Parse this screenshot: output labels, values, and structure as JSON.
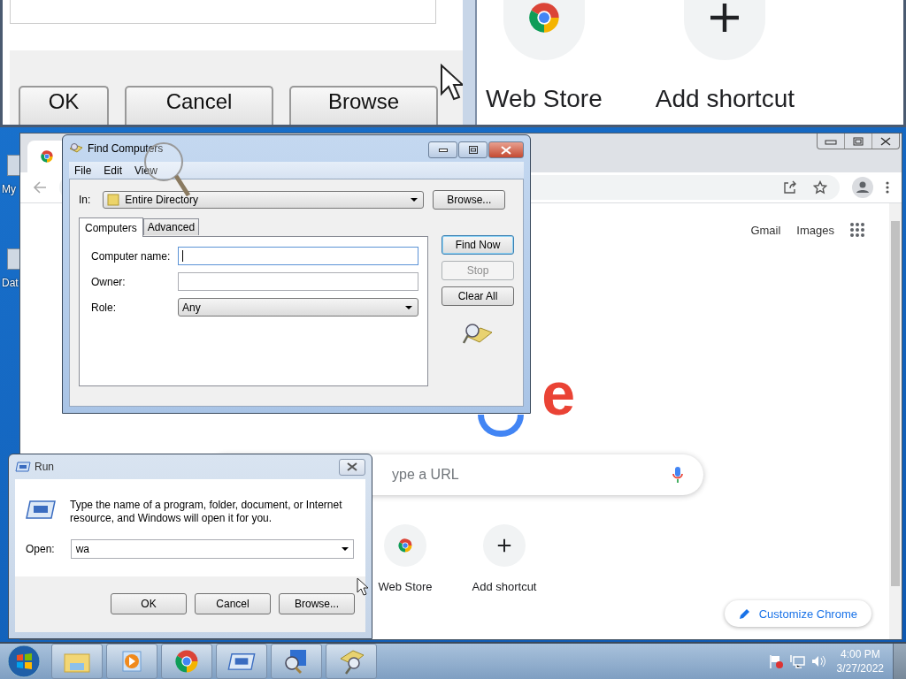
{
  "magnifier": {
    "buttons": [
      "OK",
      "Cancel",
      "Browse"
    ],
    "shortcuts": [
      {
        "label": "Web Store",
        "kind": "webstore"
      },
      {
        "label": "Add shortcut",
        "kind": "add"
      }
    ]
  },
  "desktop_icons": [
    "My",
    "Dat"
  ],
  "chrome": {
    "links": [
      "Gmail",
      "Images"
    ],
    "logo_text": "e",
    "search_placeholder": "ype a URL",
    "shortcuts": [
      {
        "label": "Web Store",
        "kind": "webstore"
      },
      {
        "label": "Add shortcut",
        "kind": "add"
      }
    ],
    "customize": "Customize Chrome"
  },
  "find_computers": {
    "title": "Find Computers",
    "menu": [
      "File",
      "Edit",
      "View"
    ],
    "in_label": "In:",
    "in_value": "Entire Directory",
    "browse": "Browse...",
    "tabs": [
      {
        "label": "Computers",
        "selected": true
      },
      {
        "label": "Advanced",
        "selected": false
      }
    ],
    "fields": [
      {
        "label": "Computer name:",
        "kind": "text",
        "focused": true
      },
      {
        "label": "Owner:",
        "kind": "text",
        "focused": false
      },
      {
        "label": "Role:",
        "kind": "dropdown",
        "value": "Any",
        "focused": false
      }
    ],
    "buttons": [
      {
        "label": "Find Now",
        "disabled": false,
        "default": true
      },
      {
        "label": "Stop",
        "disabled": true,
        "default": false
      },
      {
        "label": "Clear All",
        "disabled": false,
        "default": false
      }
    ]
  },
  "run": {
    "title": "Run",
    "message": "Type the name of a program, folder, document, or Internet resource, and Windows will open it for you.",
    "open_label": "Open:",
    "open_value": "wa",
    "buttons": [
      "OK",
      "Cancel",
      "Browse..."
    ]
  },
  "taskbar": {
    "items": [
      {
        "kind": "folder"
      },
      {
        "kind": "media"
      },
      {
        "kind": "chrome"
      },
      {
        "kind": "run"
      },
      {
        "kind": "network"
      },
      {
        "kind": "find"
      }
    ],
    "time": "4:00 PM",
    "date": "3/27/2022"
  }
}
